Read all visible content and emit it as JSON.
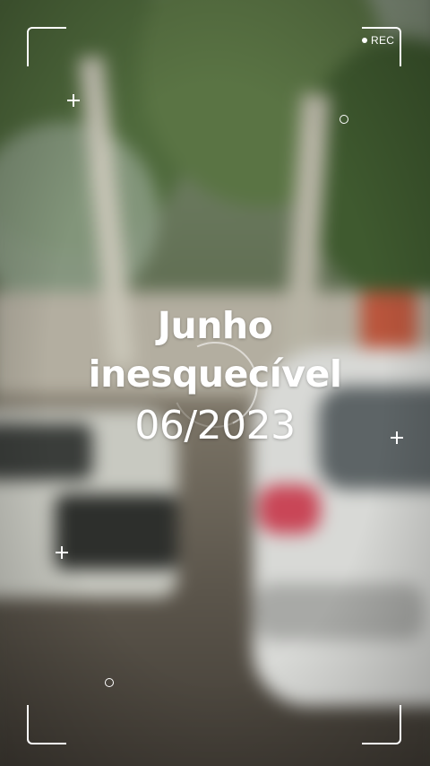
{
  "overlay": {
    "rec_label": "REC",
    "accent_color": "#ffffff"
  },
  "caption": {
    "line1": "Junho",
    "line2": "inesquecível",
    "date": "06/2023"
  },
  "icons": {
    "recording_dot": "rec-dot-icon",
    "viewfinder_corners": "viewfinder-corner-icon",
    "crosshair": "plus-icon",
    "focus_marker": "circle-icon"
  }
}
